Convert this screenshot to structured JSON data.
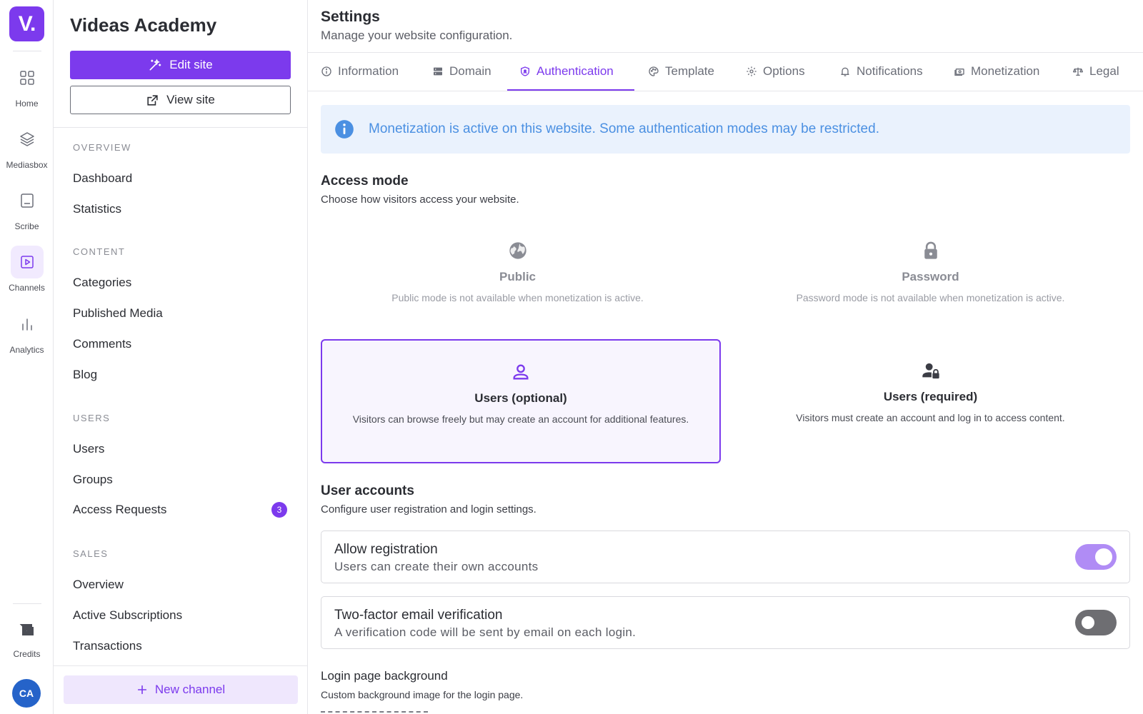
{
  "rail": {
    "logo": "V.",
    "items": [
      {
        "label": "Home",
        "icon": "grid-icon"
      },
      {
        "label": "Mediasbox",
        "icon": "layers-icon"
      },
      {
        "label": "Scribe",
        "icon": "document-icon"
      },
      {
        "label": "Channels",
        "icon": "play-icon"
      },
      {
        "label": "Analytics",
        "icon": "bar-chart-icon"
      },
      {
        "label": "Credits",
        "icon": "wallet-icon"
      }
    ],
    "avatar": "CA"
  },
  "sidebar": {
    "site_title": "Videas Academy",
    "edit_label": "Edit site",
    "view_label": "View site",
    "sections": [
      {
        "heading": "OVERVIEW",
        "items": [
          "Dashboard",
          "Statistics"
        ]
      },
      {
        "heading": "CONTENT",
        "items": [
          "Categories",
          "Published Media",
          "Comments",
          "Blog"
        ]
      },
      {
        "heading": "USERS",
        "items": [
          "Users",
          "Groups",
          "Access Requests"
        ]
      },
      {
        "heading": "SALES",
        "items": [
          "Overview",
          "Active Subscriptions",
          "Transactions"
        ]
      }
    ],
    "access_requests_count": "3",
    "new_channel_label": "New channel"
  },
  "header": {
    "title": "Settings",
    "subtitle": "Manage your website configuration."
  },
  "tabs": [
    {
      "label": "Information",
      "icon": "info-icon"
    },
    {
      "label": "Domain",
      "icon": "server-icon"
    },
    {
      "label": "Authentication",
      "icon": "shield-icon",
      "active": true
    },
    {
      "label": "Template",
      "icon": "palette-icon"
    },
    {
      "label": "Options",
      "icon": "gear-icon"
    },
    {
      "label": "Notifications",
      "icon": "bell-icon"
    },
    {
      "label": "Monetization",
      "icon": "money-icon"
    },
    {
      "label": "Legal",
      "icon": "scale-icon"
    }
  ],
  "alert": {
    "text": "Monetization is active on this website. Some authentication modes may be restricted."
  },
  "access_mode": {
    "title": "Access mode",
    "description": "Choose how visitors access your website.",
    "modes": [
      {
        "title": "Public",
        "description": "Public mode is not available when monetization is active.",
        "icon": "globe-icon",
        "state": "disabled"
      },
      {
        "title": "Password",
        "description": "Password mode is not available when monetization is active.",
        "icon": "lock-icon",
        "state": "disabled"
      },
      {
        "title": "Users (optional)",
        "description": "Visitors can browse freely but may create an account for additional features.",
        "icon": "user-icon",
        "state": "selected"
      },
      {
        "title": "Users (required)",
        "description": "Visitors must create an account and log in to access content.",
        "icon": "user-lock-icon",
        "state": "available"
      }
    ]
  },
  "user_accounts": {
    "title": "User accounts",
    "description": "Configure user registration and login settings.",
    "settings": [
      {
        "title": "Allow registration",
        "description": "Users can create their own accounts",
        "enabled": true
      },
      {
        "title": "Two-factor email verification",
        "description": "A verification code will be sent by email on each login.",
        "enabled": false
      }
    ]
  },
  "login_background": {
    "title": "Login page background",
    "description": "Custom background image for the login page."
  },
  "colors": {
    "accent": "#7c3aed",
    "alert_bg": "#eaf2fd",
    "alert_text": "#4b90e2",
    "avatar": "#2563c9"
  }
}
